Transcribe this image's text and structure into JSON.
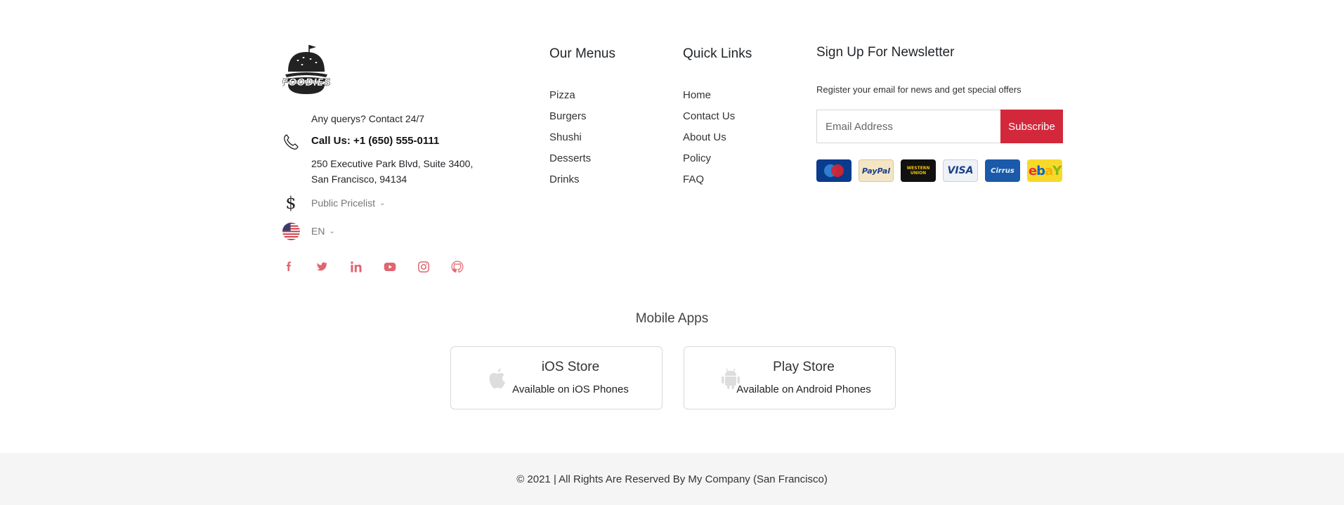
{
  "brand": {
    "logo_text": "FOODIES",
    "accent": "#d3283c"
  },
  "contact": {
    "note": "Any querys? Contact 24/7",
    "call": "Call Us: +1 (650) 555-0111",
    "address_line1": "250 Executive Park Blvd, Suite 3400,",
    "address_line2": "San Francisco, 94134"
  },
  "pricelist": {
    "selected": "Public Pricelist"
  },
  "language": {
    "selected": "EN"
  },
  "socials": [
    "facebook-icon",
    "twitter-icon",
    "linkedin-icon",
    "youtube-icon",
    "instagram-icon",
    "github-icon"
  ],
  "menus": {
    "title": "Our Menus",
    "items": [
      "Pizza",
      "Burgers",
      "Shushi",
      "Desserts",
      "Drinks"
    ]
  },
  "quick_links": {
    "title": "Quick Links",
    "items": [
      "Home",
      "Contact Us",
      "About Us",
      "Policy",
      "FAQ"
    ]
  },
  "newsletter": {
    "title": "Sign Up For Newsletter",
    "subtitle": "Register your email for news and get special offers",
    "placeholder": "Email Address",
    "button": "Subscribe"
  },
  "payments": {
    "paypal": "PayPal",
    "western_union_1": "WESTERN",
    "western_union_2": "UNION",
    "visa": "VISA",
    "cirrus": "Cirrus",
    "ebay_e": "e",
    "ebay_b": "b",
    "ebay_a": "a",
    "ebay_y": "Y"
  },
  "mobile_apps": {
    "title": "Mobile Apps",
    "ios": {
      "name": "iOS Store",
      "sub": "Available on iOS Phones"
    },
    "android": {
      "name": "Play Store",
      "sub": "Available on Android Phones"
    }
  },
  "footer": {
    "copyright": "© 2021 | All Rights Are Reserved By My Company (San Francisco)"
  }
}
